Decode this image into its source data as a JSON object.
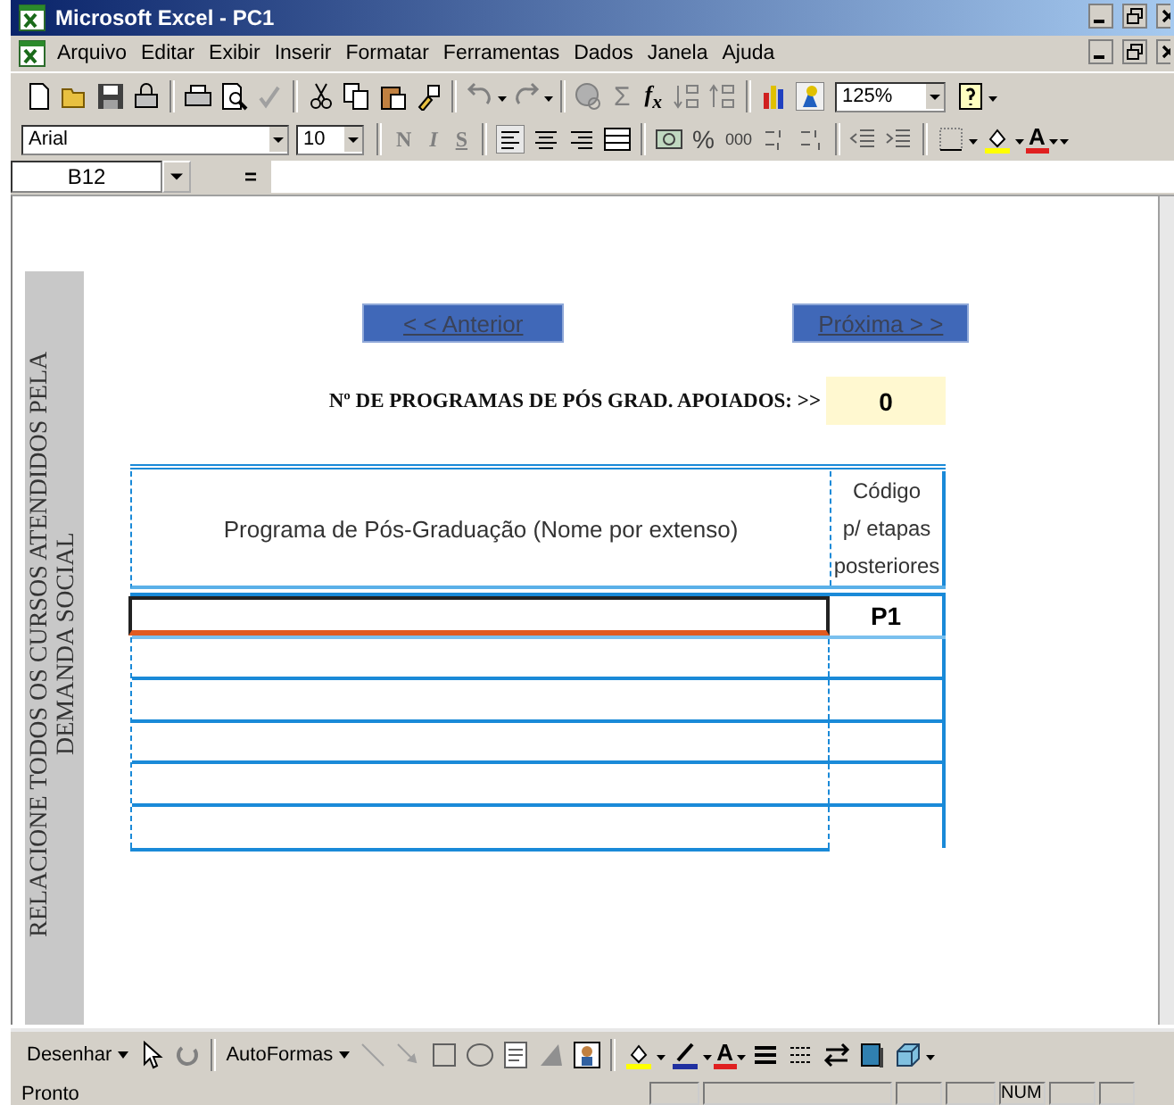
{
  "window": {
    "title": "Microsoft Excel - PC1"
  },
  "menu": [
    "Arquivo",
    "Editar",
    "Exibir",
    "Inserir",
    "Formatar",
    "Ferramentas",
    "Dados",
    "Janela",
    "Ajuda"
  ],
  "standard_toolbar": {
    "autosum": "Σ",
    "function": "f$_{x}$",
    "zoom": "125%"
  },
  "formatting_toolbar": {
    "font": "Arial",
    "size": "10",
    "style_buttons": [
      "N",
      "I",
      "S"
    ],
    "percent": "%",
    "thousands": "000",
    "font_color_letter": "A"
  },
  "formula_bar": {
    "name_box": "B12",
    "equals": "="
  },
  "sheet": {
    "side_note": "RELACIONE TODOS OS CURSOS  ATENDIDOS PELA DEMANDA SOCIAL",
    "nav_buttons": [
      "< < Anterior",
      "Próxima > >"
    ],
    "counter": {
      "label": "Nº DE PROGRAMAS DE PÓS GRAD. APOIADOS: >>",
      "value": "0"
    },
    "table": {
      "columns": [
        "Programa de Pós-Graduação (Nome por extenso)",
        "Código\np/ etapas\nposteriores"
      ],
      "rows": [
        {
          "selected": true,
          "code": "P1"
        },
        {
          "selected": false
        },
        {
          "selected": false
        },
        {
          "selected": false
        },
        {
          "selected": false
        },
        {
          "selected": false
        }
      ]
    }
  },
  "drawing_toolbar": {
    "draw_menu": "Desenhar",
    "autoshapes_menu": "AutoFormas",
    "font_color_letter": "A"
  },
  "status_bar": {
    "status": "Pronto",
    "num_lock": "NUM"
  }
}
